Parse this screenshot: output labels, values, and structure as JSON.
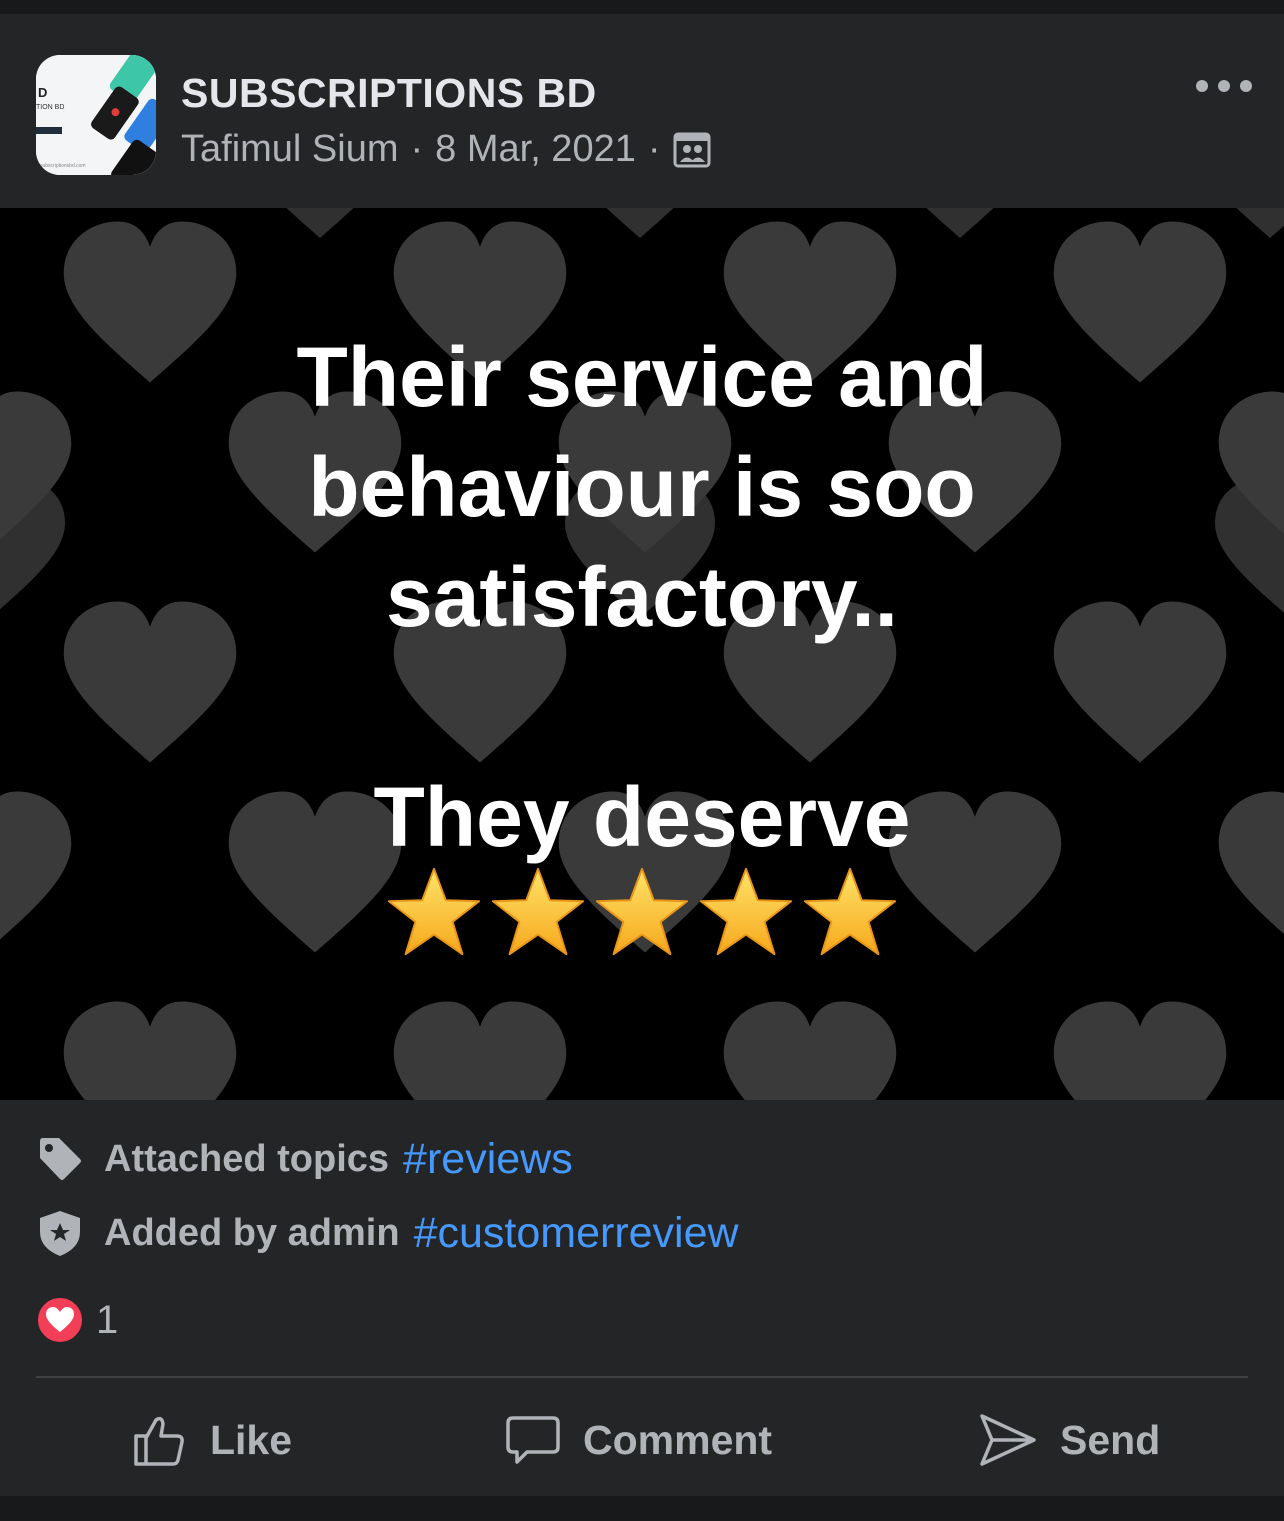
{
  "post": {
    "page_name": "SUBSCRIPTIONS BD",
    "author": "Tafimul Sium",
    "separator": "·",
    "date": "8 Mar, 2021",
    "audience_icon": "group-audience-icon",
    "more_icon": "more-options-icon",
    "avatar_icon": "page-avatar"
  },
  "image": {
    "line1": "Their service and behaviour is soo satisfactory..",
    "line2": "They deserve",
    "stars": "⭐⭐⭐⭐⭐",
    "background": "dark hearts pattern"
  },
  "topics": {
    "attached_label": "Attached topics",
    "attached_tag": "#reviews",
    "admin_label": "Added by admin",
    "admin_tag": "#customerreview"
  },
  "reactions": {
    "type_icon": "love-reaction-icon",
    "count": "1"
  },
  "actions": {
    "like": "Like",
    "comment": "Comment",
    "send": "Send"
  },
  "colors": {
    "card_bg": "#242526",
    "page_bg": "#18191a",
    "text_primary": "#e4e6eb",
    "text_secondary": "#b0b3b8",
    "link": "#4599ff",
    "love": "#f33e58"
  }
}
